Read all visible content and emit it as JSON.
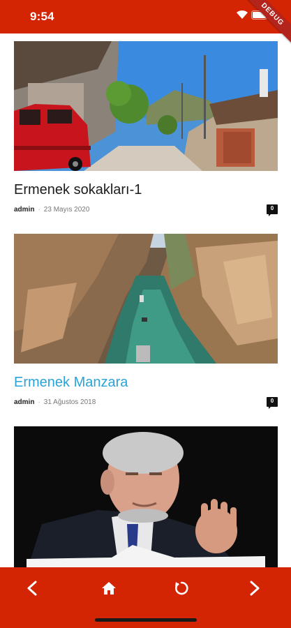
{
  "status_bar": {
    "time": "9:54",
    "debug_label": "DEBUG",
    "icons": [
      "wifi-icon",
      "battery-icon"
    ]
  },
  "posts": [
    {
      "title": "Ermenek sokakları-1",
      "author": "admin",
      "date": "23 Mayıs 2020",
      "comments": "0",
      "image": "street-photo",
      "title_color": "#1c1c1c"
    },
    {
      "title": "Ermenek Manzara",
      "author": "admin",
      "date": "31 Ağustos 2018",
      "comments": "0",
      "image": "canyon-photo",
      "title_color": "#2aa3d8"
    },
    {
      "title": "",
      "author": "",
      "date": "",
      "comments": "",
      "image": "portrait-photo"
    }
  ],
  "bottom_nav": {
    "items": [
      "back-icon",
      "home-icon",
      "refresh-icon",
      "forward-icon"
    ]
  },
  "colors": {
    "brand": "#d32404",
    "link": "#2aa3d8"
  }
}
